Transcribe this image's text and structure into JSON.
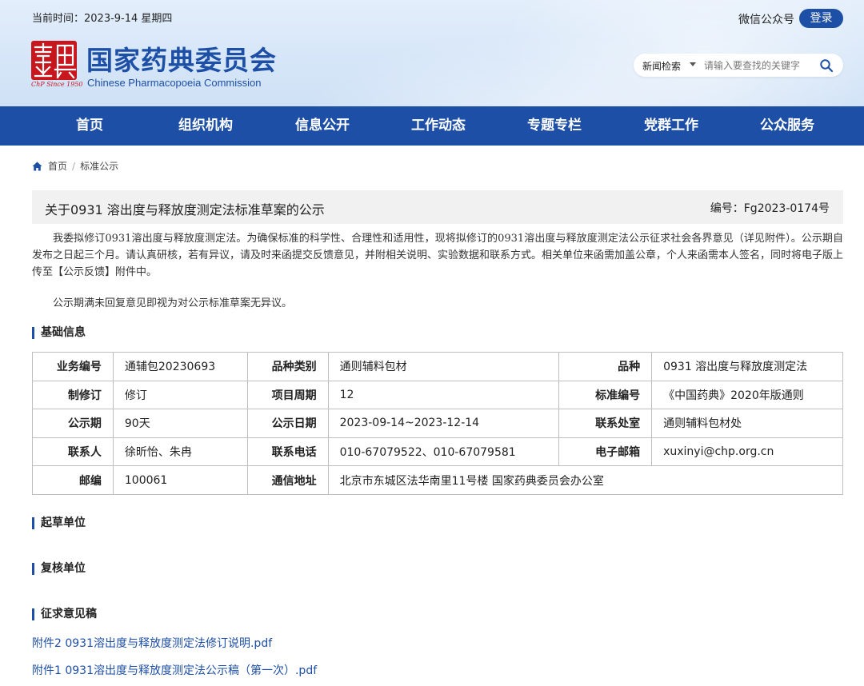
{
  "header": {
    "date_label": "当前时间：2023-9-14 星期四",
    "wechat": "微信公众号",
    "login": "登录",
    "logo_since": "ChP Since 1950",
    "org_cn": "国家药典委员会",
    "org_en": "Chinese Pharmacopoeia Commission"
  },
  "search": {
    "category": "新闻检索",
    "placeholder": "请输入要查找的关键字",
    "icon": "search-icon"
  },
  "nav": [
    "首页",
    "组织机构",
    "信息公开",
    "工作动态",
    "专题专栏",
    "党群工作",
    "公众服务"
  ],
  "breadcrumb": {
    "home": "首页",
    "sep": "/",
    "current": "标准公示"
  },
  "notice": {
    "title": "关于0931 溶出度与释放度测定法标准草案的公示",
    "number": "编号：Fg2023-0174号",
    "para1": "我委拟修订0931溶出度与释放度测定法。为确保标准的科学性、合理性和适用性，现将拟修订的0931溶出度与释放度测定法公示征求社会各界意见（详见附件）。公示期自发布之日起三个月。请认真研核，若有异议，请及时来函提交反馈意见，并附相关说明、实验数据和联系方式。相关单位来函需加盖公章，个人来函需本人签名，同时将电子版上传至【公示反馈】附件中。",
    "para2": "公示期满未回复意见即视为对公示标准草案无异议。"
  },
  "sections": {
    "basic": "基础信息",
    "drafting": "起草单位",
    "review": "复核单位",
    "draft_docs": "征求意见稿"
  },
  "table": {
    "r1": {
      "l1": "业务编号",
      "v1": "通辅包20230693",
      "l2": "品种类别",
      "v2": "通则辅料包材",
      "l3": "品种",
      "v3": "0931 溶出度与释放度测定法"
    },
    "r2": {
      "l1": "制修订",
      "v1": "修订",
      "l2": "项目周期",
      "v2": "12",
      "l3": "标准编号",
      "v3": "《中国药典》2020年版通则"
    },
    "r3": {
      "l1": "公示期",
      "v1": "90天",
      "l2": "公示日期",
      "v2": "2023-09-14~2023-12-14",
      "l3": "联系处室",
      "v3": "通则辅料包材处"
    },
    "r4": {
      "l1": "联系人",
      "v1": "徐昕怡、朱冉",
      "l2": "联系电话",
      "v2": "010-67079522、010-67079581",
      "l3": "电子邮箱",
      "v3": "xuxinyi@chp.org.cn"
    },
    "r5": {
      "l1": "邮编",
      "v1": "100061",
      "l2": "通信地址",
      "v2": "北京市东城区法华南里11号楼 国家药典委员会办公室"
    }
  },
  "attachments": [
    "附件2 0931溶出度与释放度测定法修订说明.pdf",
    "附件1 0931溶出度与释放度测定法公示稿（第一次）.pdf"
  ]
}
